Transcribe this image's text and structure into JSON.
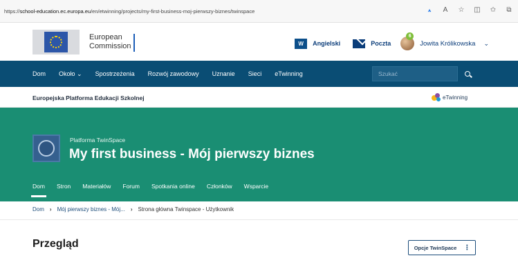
{
  "browser": {
    "url": "https://school-education.ec.europa.eu/en/etwinning/projects/my-first-business-moj-pierwszy-biznes/twinspace",
    "tools": [
      "read-aloud-icon",
      "text-size-icon",
      "favorite-star-icon",
      "split-screen-icon",
      "favorites-icon",
      "collections-icon"
    ]
  },
  "header": {
    "org_line1": "European",
    "org_line2": "Commission",
    "lang_code": "W",
    "language": "Angielski",
    "mail": "Poczta",
    "notif_count": "6",
    "user": "Jowita Królikowska"
  },
  "nav": {
    "items": [
      "Dom",
      "Około",
      "Spostrzeżenia",
      "Rozwój zawodowy",
      "Uznanie",
      "Sieci",
      "eTwinning"
    ],
    "search_placeholder": "Szukać"
  },
  "platform": {
    "title": "Europejska Platforma Edukacji Szkolnej",
    "etwinning_logo": "eTwinning"
  },
  "hero": {
    "subtitle": "Platforma TwinSpace",
    "title": "My first business - Mój pierwszy biznes",
    "tabs": [
      "Dom",
      "Stron",
      "Materiałów",
      "Forum",
      "Spotkania online",
      "Członków",
      "Wsparcie"
    ]
  },
  "breadcrumb": {
    "items": [
      "Dom",
      "Mój pierwszy biznes - Mój...",
      "Strona główna Twinspace - Użytkownik"
    ]
  },
  "content": {
    "title": "Przegląd",
    "options_label": "Opcje TwinSpace"
  },
  "colors": {
    "nav_bg": "#0a4d74",
    "hero_bg": "#1a8e73",
    "link": "#1b4c7a"
  }
}
